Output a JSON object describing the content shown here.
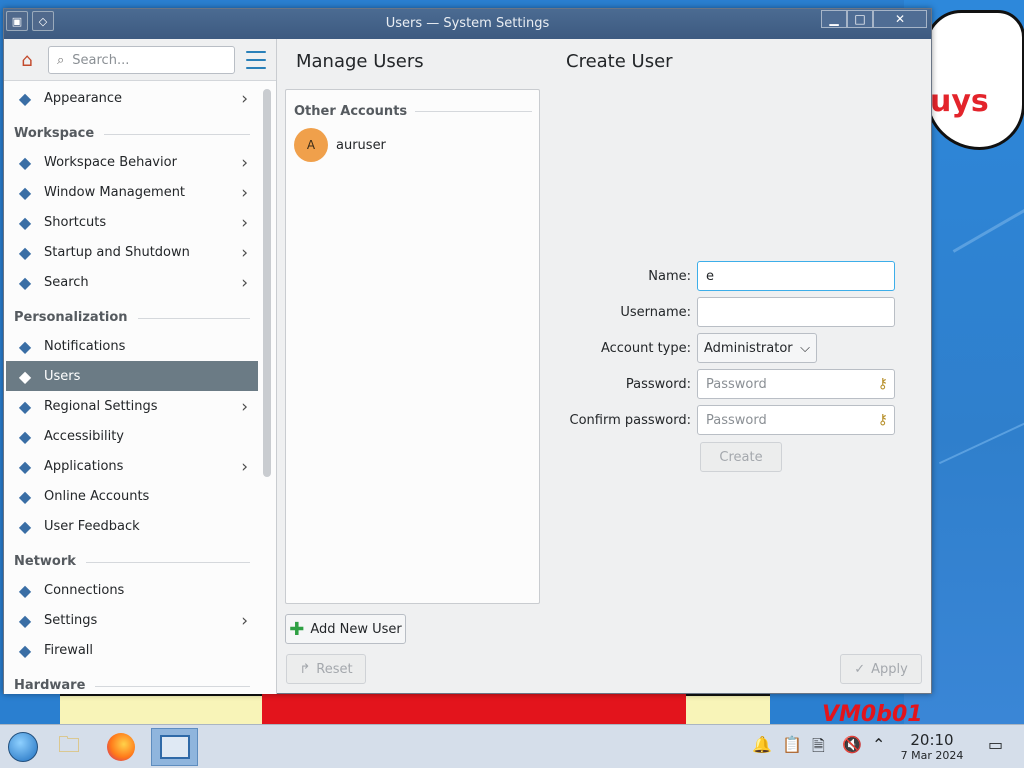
{
  "window": {
    "title": "Users — System Settings"
  },
  "sidebar": {
    "search_placeholder": "Search...",
    "top_item": {
      "label": "Appearance",
      "icon": "appearance-icon",
      "chevron": true
    },
    "sections": [
      {
        "title": "Workspace",
        "items": [
          {
            "label": "Workspace Behavior",
            "icon": "workspace-behavior-icon",
            "chevron": true
          },
          {
            "label": "Window Management",
            "icon": "window-management-icon",
            "chevron": true
          },
          {
            "label": "Shortcuts",
            "icon": "keyboard-icon",
            "chevron": true
          },
          {
            "label": "Startup and Shutdown",
            "icon": "startup-icon",
            "chevron": true
          },
          {
            "label": "Search",
            "icon": "search-icon",
            "chevron": true
          }
        ]
      },
      {
        "title": "Personalization",
        "items": [
          {
            "label": "Notifications",
            "icon": "bell-icon",
            "chevron": false
          },
          {
            "label": "Users",
            "icon": "users-icon",
            "chevron": false,
            "active": true
          },
          {
            "label": "Regional Settings",
            "icon": "globe-icon",
            "chevron": true
          },
          {
            "label": "Accessibility",
            "icon": "accessibility-icon",
            "chevron": false
          },
          {
            "label": "Applications",
            "icon": "applications-icon",
            "chevron": true
          },
          {
            "label": "Online Accounts",
            "icon": "online-accounts-icon",
            "chevron": false
          },
          {
            "label": "User Feedback",
            "icon": "feedback-icon",
            "chevron": false
          }
        ]
      },
      {
        "title": "Network",
        "items": [
          {
            "label": "Connections",
            "icon": "network-globe-icon",
            "chevron": false
          },
          {
            "label": "Settings",
            "icon": "network-settings-icon",
            "chevron": true
          },
          {
            "label": "Firewall",
            "icon": "firewall-icon",
            "chevron": false
          }
        ]
      },
      {
        "title": "Hardware",
        "items": []
      }
    ]
  },
  "manage": {
    "title": "Manage Users",
    "section_title": "Other Accounts",
    "users": [
      {
        "initial": "A",
        "name": "auruser"
      }
    ],
    "add_button": "Add New User",
    "reset_button": "Reset"
  },
  "create": {
    "title": "Create User",
    "name_label": "Name:",
    "name_value": "e",
    "username_label": "Username:",
    "username_value": "",
    "account_type_label": "Account type:",
    "account_type_value": "Administrator",
    "password_label": "Password:",
    "password_placeholder": "Password",
    "confirm_label": "Confirm password:",
    "confirm_placeholder": "Password",
    "create_button": "Create",
    "apply_button": "Apply"
  },
  "taskbar": {
    "time": "20:10",
    "date": "7 Mar 2024"
  },
  "desktop": {
    "wallpaper_text_1": "uys",
    "wallpaper_text_2": "VM0b01"
  },
  "colors": {
    "titlebar": "#3d5a80",
    "active_item": "#6b7b85",
    "accent": "#3daee9"
  }
}
